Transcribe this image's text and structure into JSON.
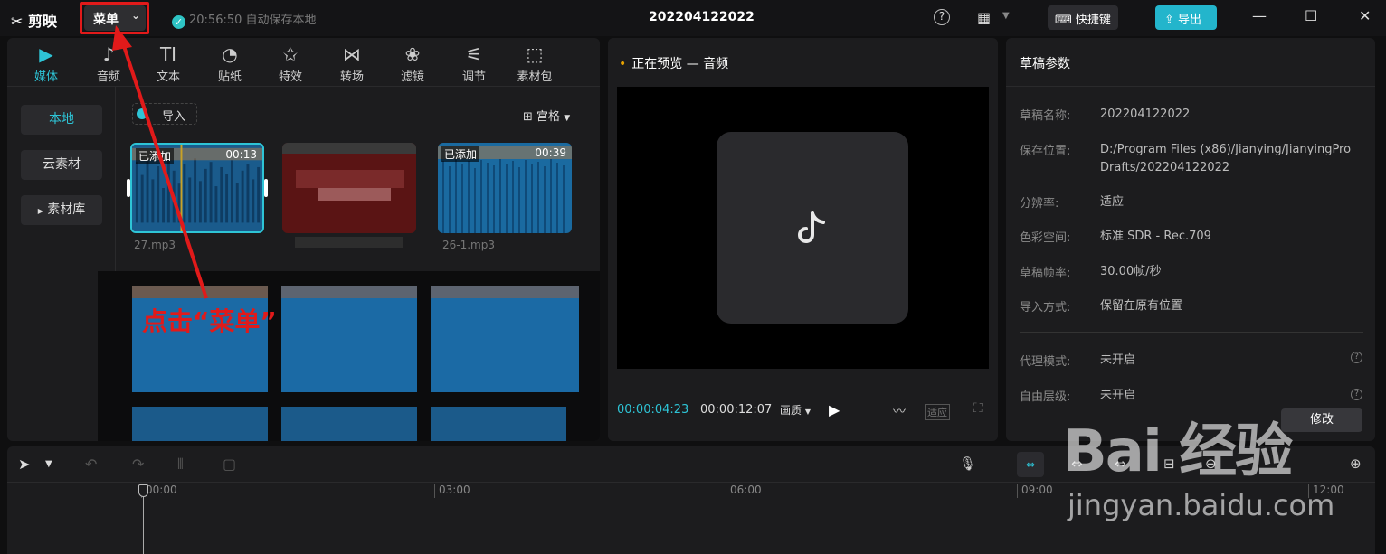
{
  "app": {
    "logo_text": "剪映",
    "menu_label": "菜单",
    "save_status": "20:56:50 自动保存本地",
    "project_title": "202204122022",
    "shortcut_label": "快捷键",
    "export_label": "导出",
    "accent_color": "#23b5cc"
  },
  "left_panel": {
    "tabs": [
      {
        "label": "媒体",
        "icon": "media-icon"
      },
      {
        "label": "音频",
        "icon": "audio-icon"
      },
      {
        "label": "文本",
        "icon": "text-icon"
      },
      {
        "label": "贴纸",
        "icon": "sticker-icon"
      },
      {
        "label": "特效",
        "icon": "effects-icon"
      },
      {
        "label": "转场",
        "icon": "transition-icon"
      },
      {
        "label": "滤镜",
        "icon": "filter-icon"
      },
      {
        "label": "调节",
        "icon": "adjust-icon"
      },
      {
        "label": "素材包",
        "icon": "package-icon"
      }
    ],
    "side_nav": [
      "本地",
      "云素材",
      "素材库"
    ],
    "import_label": "导入",
    "view_label": "宫格",
    "media": [
      {
        "name": "27.mp3",
        "badge": "已添加",
        "duration": "00:13"
      },
      {
        "name": "26-1.mp3",
        "badge": "已添加",
        "duration": "00:39"
      }
    ]
  },
  "annotation": {
    "text": "点击“菜单”",
    "color": "#e11a1a"
  },
  "preview": {
    "title": "正在预览 — 音频",
    "current_time": "00:00:04:23",
    "total_time": "00:00:12:07",
    "quality_label": "画质",
    "fit_label": "适应"
  },
  "draft_params": {
    "title": "草稿参数",
    "rows": [
      {
        "key": "草稿名称:",
        "value": "202204122022"
      },
      {
        "key": "保存位置:",
        "value": "D:/Program Files (x86)/Jianying/JianyingPro Drafts/202204122022"
      },
      {
        "key": "分辨率:",
        "value": "适应"
      },
      {
        "key": "色彩空间:",
        "value": "标准 SDR - Rec.709"
      },
      {
        "key": "草稿帧率:",
        "value": "30.00帧/秒"
      },
      {
        "key": "导入方式:",
        "value": "保留在原有位置"
      },
      {
        "key": "代理模式:",
        "value": "未开启"
      },
      {
        "key": "自由层级:",
        "value": "未开启"
      }
    ],
    "modify_label": "修改"
  },
  "timeline": {
    "ruler": [
      "00:00",
      "03:00",
      "06:00",
      "09:00",
      "12:00"
    ]
  },
  "watermark": {
    "brand": "Bai 经验",
    "url": "jingyan.baidu.com"
  }
}
